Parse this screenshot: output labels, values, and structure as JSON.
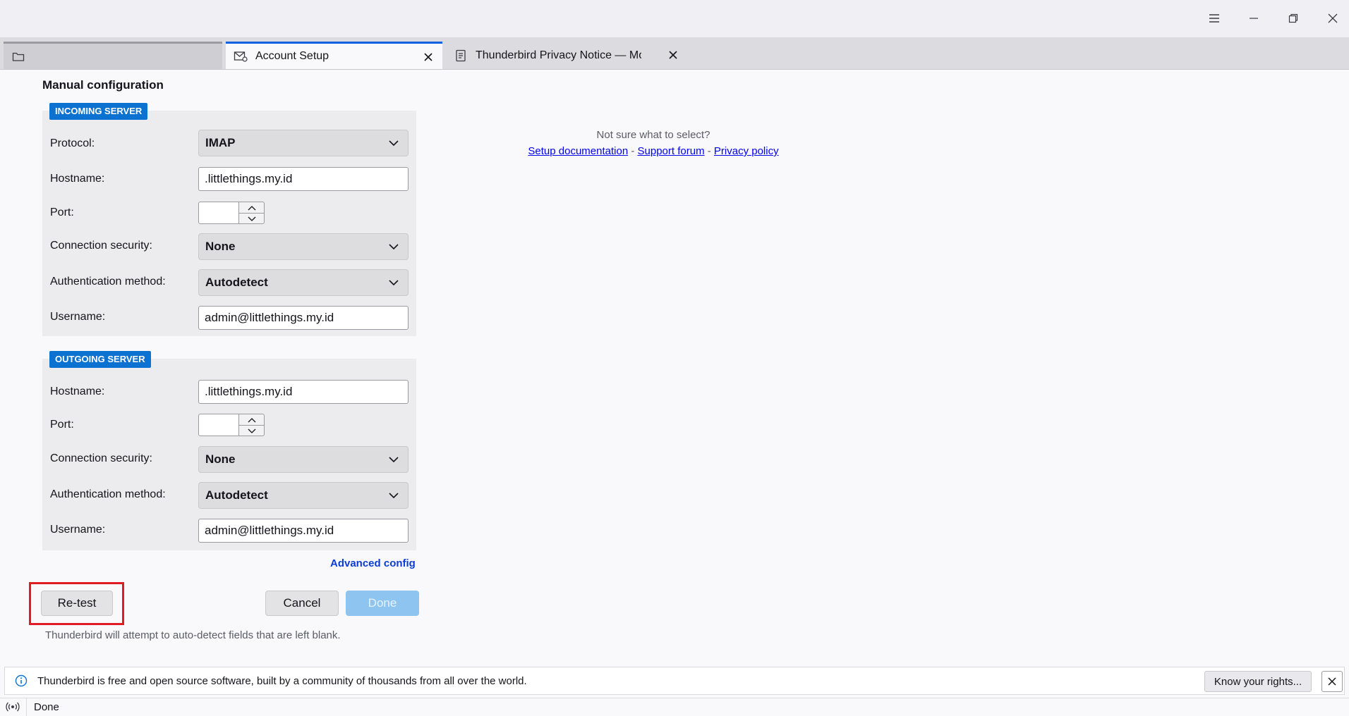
{
  "window": {
    "controls": [
      "menu-icon",
      "minimize-icon",
      "restore-icon",
      "close-icon"
    ]
  },
  "tabs": [
    {
      "label": "",
      "icon": "folder-icon"
    },
    {
      "label": "Account Setup",
      "icon": "account-setup-icon"
    },
    {
      "label": "Thunderbird Privacy Notice — Mozi",
      "icon": "document-icon"
    }
  ],
  "page": {
    "heading": "Manual configuration",
    "incoming": {
      "legend": "INCOMING SERVER",
      "protocol_label": "Protocol:",
      "protocol_value": "IMAP",
      "hostname_label": "Hostname:",
      "hostname_value": ".littlethings.my.id",
      "port_label": "Port:",
      "port_value": "",
      "security_label": "Connection security:",
      "security_value": "None",
      "auth_label": "Authentication method:",
      "auth_value": "Autodetect",
      "username_label": "Username:",
      "username_value": "admin@littlethings.my.id"
    },
    "outgoing": {
      "legend": "OUTGOING SERVER",
      "hostname_label": "Hostname:",
      "hostname_value": ".littlethings.my.id",
      "port_label": "Port:",
      "port_value": "",
      "security_label": "Connection security:",
      "security_value": "None",
      "auth_label": "Authentication method:",
      "auth_value": "Autodetect",
      "username_label": "Username:",
      "username_value": "admin@littlethings.my.id"
    },
    "help": {
      "question": "Not sure what to select?",
      "setup_doc": "Setup documentation",
      "support_forum": "Support forum",
      "privacy_policy": "Privacy policy",
      "separator": " - "
    },
    "advanced_config": "Advanced config",
    "buttons": {
      "retest": "Re-test",
      "cancel": "Cancel",
      "done": "Done"
    },
    "hint": "Thunderbird will attempt to auto-detect fields that are left blank."
  },
  "notification": {
    "text": "Thunderbird is free and open source software, built by a community of thousands from all over the world.",
    "button": "Know your rights..."
  },
  "statusbar": {
    "text": "Done"
  },
  "colors": {
    "accent": "#0061e0",
    "legend_bg": "#0b72d1",
    "done_disabled": "#8ec5f0",
    "highlight": "#e01b24"
  }
}
